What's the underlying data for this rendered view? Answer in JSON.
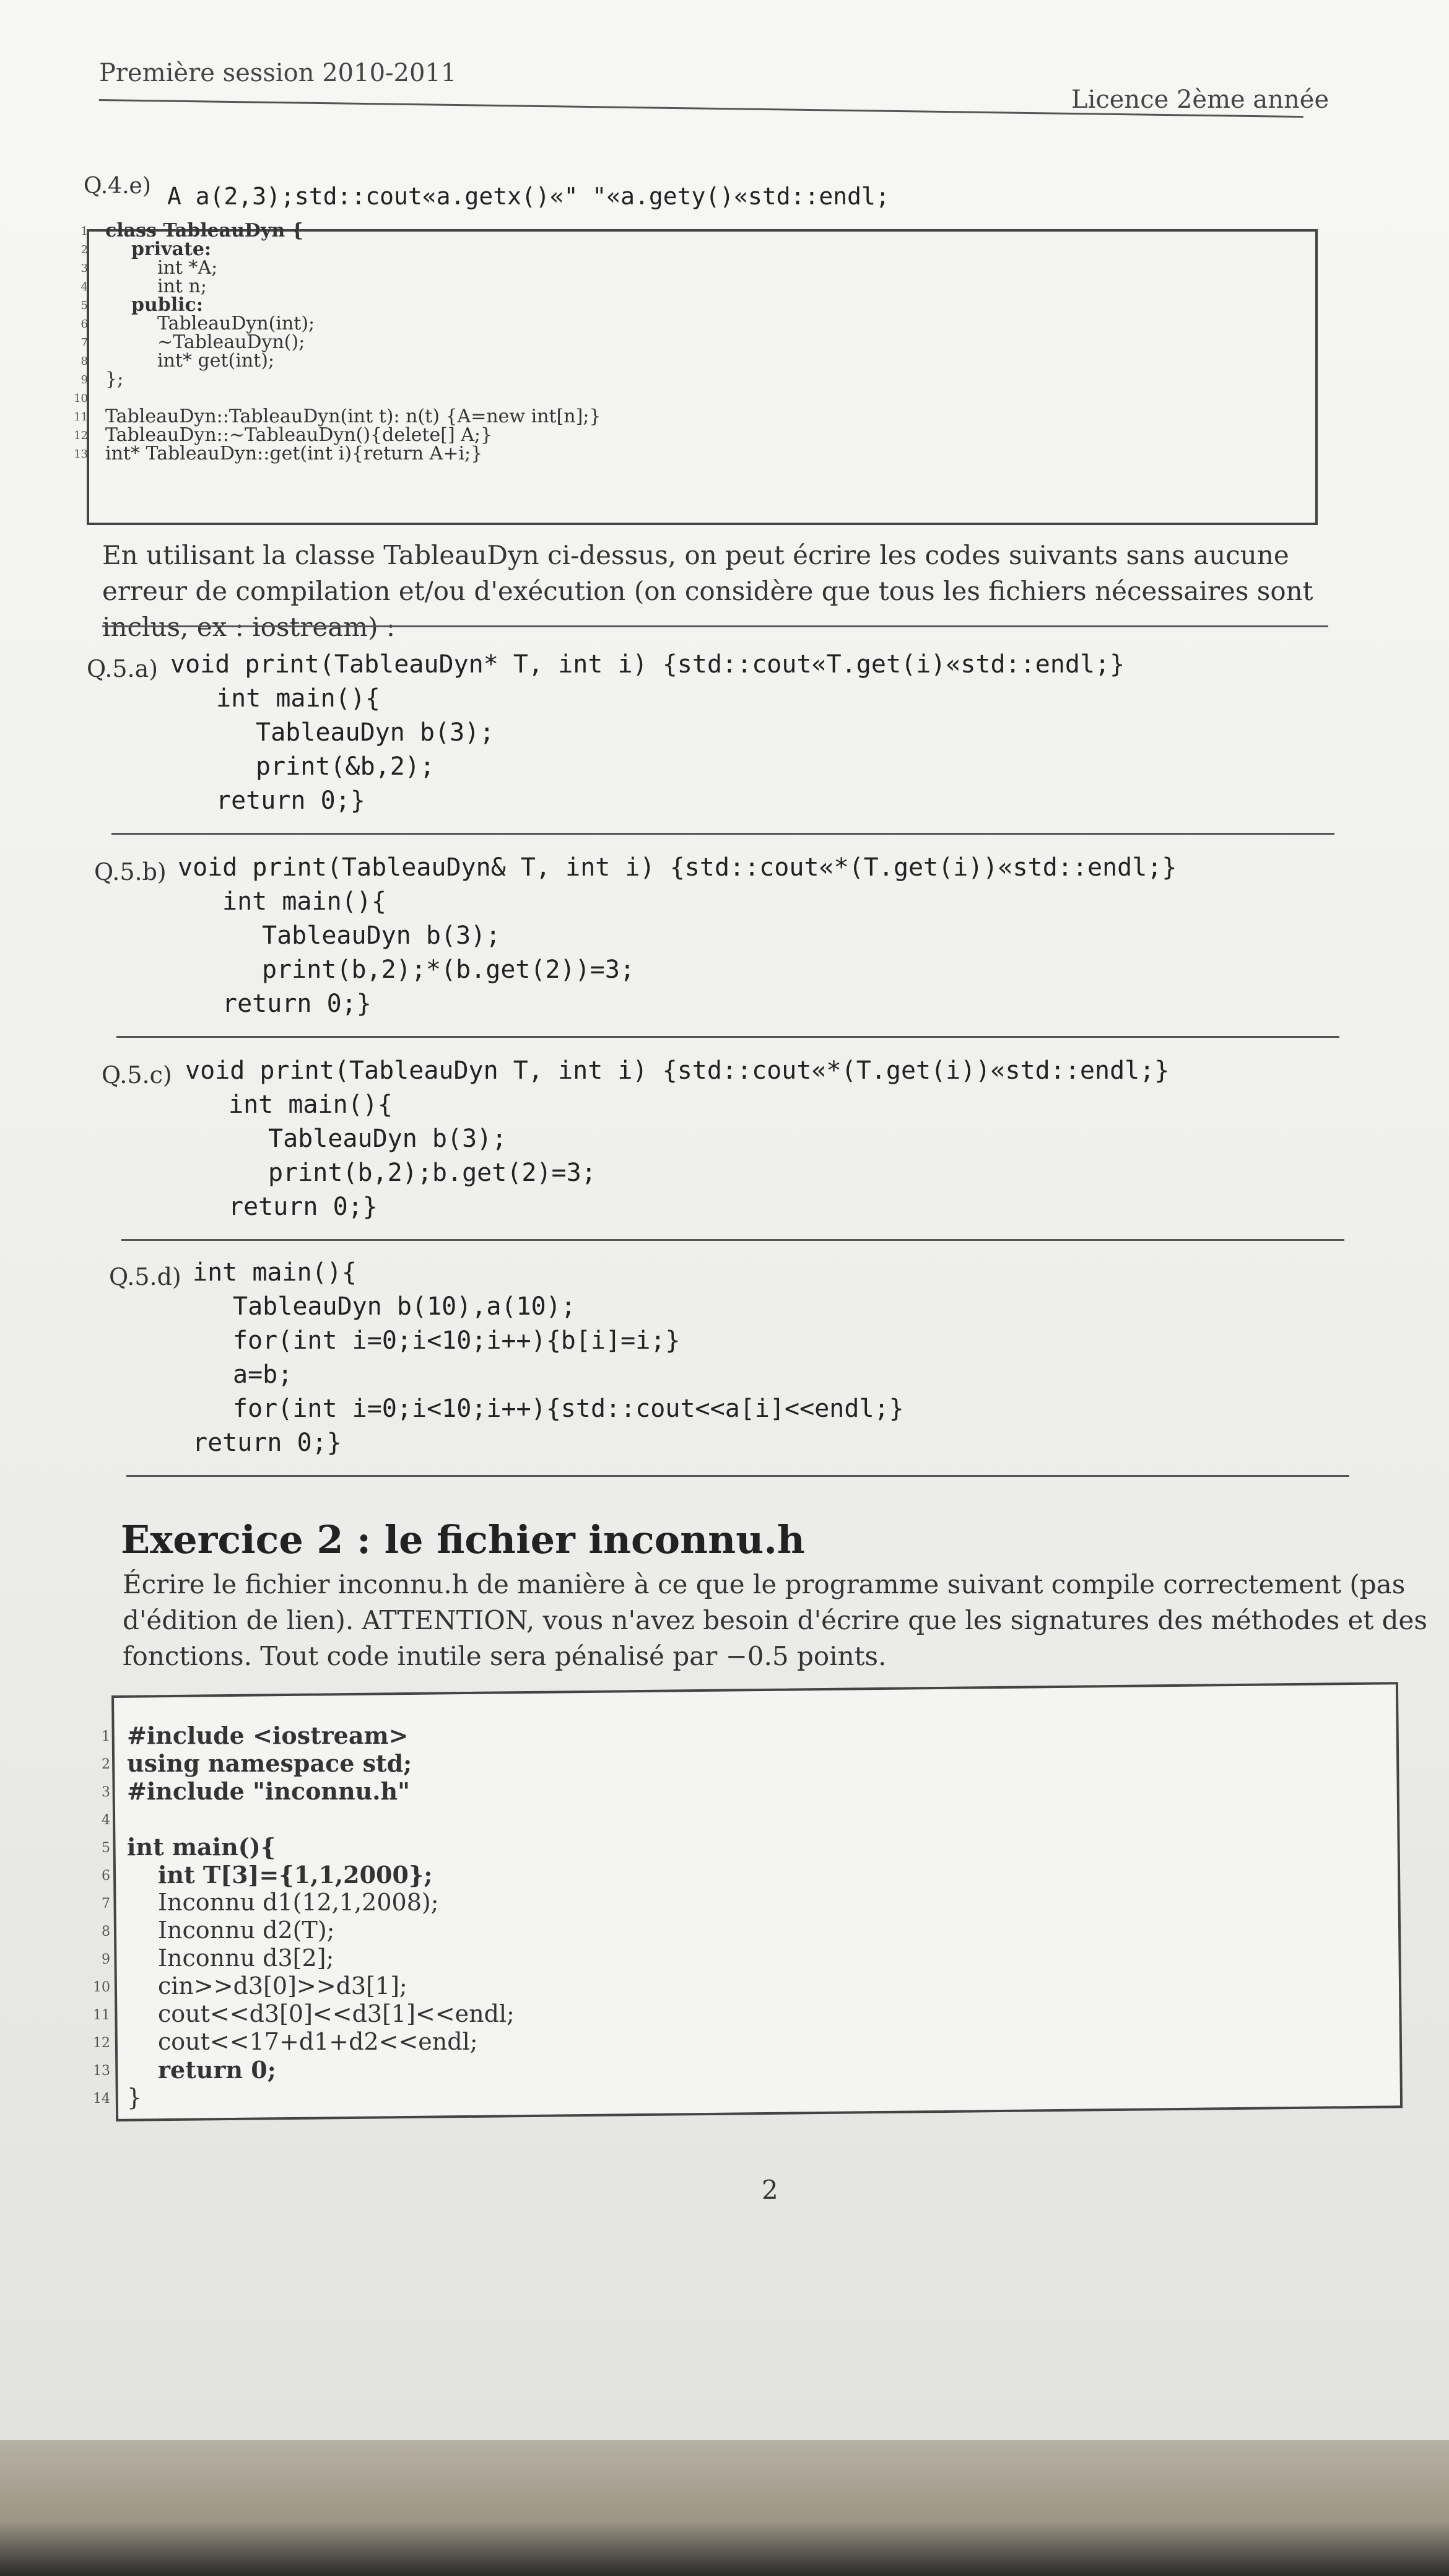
{
  "header": {
    "left": "Première session 2010-2011",
    "right": "Licence 2ème année"
  },
  "q4e": {
    "label": "Q.4.e)",
    "code": "A a(2,3);std::cout«a.getx()«\" \"«a.gety()«std::endl;"
  },
  "listing1": {
    "line_numbers": [
      "1",
      "2",
      "3",
      "4",
      "5",
      "6",
      "7",
      "8",
      "9",
      "10",
      "11",
      "12",
      "13"
    ],
    "lines": [
      "class TableauDyn {",
      "private:",
      "int *A;",
      "int n;",
      "public:",
      "TableauDyn(int);",
      "~TableauDyn();",
      "int* get(int);",
      "};",
      "",
      "TableauDyn::TableauDyn(int t): n(t) {A=new int[n];}",
      "TableauDyn::~TableauDyn(){delete[] A;}",
      "int* TableauDyn::get(int i){return A+i;}"
    ]
  },
  "intro": "En utilisant la classe TableauDyn ci-dessus, on peut écrire les codes suivants sans aucune erreur de compilation et/ou d'exécution (on considère que tous les fichiers nécessaires sont inclus, ex : iostream) :",
  "questions": [
    {
      "label": "Q.5.a)",
      "lines": [
        "void print(TableauDyn* T, int i) {std::cout«T.get(i)«std::endl;}",
        "int main(){",
        "TableauDyn b(3);",
        "print(&b,2);",
        "return 0;}"
      ]
    },
    {
      "label": "Q.5.b)",
      "lines": [
        "void print(TableauDyn& T, int i) {std::cout«*(T.get(i))«std::endl;}",
        "int main(){",
        "TableauDyn b(3);",
        "print(b,2);*(b.get(2))=3;",
        "return 0;}"
      ]
    },
    {
      "label": "Q.5.c)",
      "lines": [
        "void print(TableauDyn T, int i) {std::cout«*(T.get(i))«std::endl;}",
        "int main(){",
        "TableauDyn b(3);",
        "print(b,2);b.get(2)=3;",
        "return 0;}"
      ]
    },
    {
      "label": "Q.5.d)",
      "lines": [
        "int main(){",
        "TableauDyn b(10),a(10);",
        "for(int i=0;i<10;i++){b[i]=i;}",
        "a=b;",
        "for(int i=0;i<10;i++){std::cout<<a[i]<<endl;}",
        "return 0;}"
      ]
    }
  ],
  "exercise2": {
    "title": "Exercice 2 : le fichier inconnu.h",
    "para": [
      "Écrire le fichier inconnu.h de manière à ce que le programme suivant compile correctement (pas",
      "d'édition de lien). ATTENTION, vous n'avez besoin d'écrire que les signatures des méthodes et des",
      "fonctions. Tout code inutile sera pénalisé par −0.5 points."
    ],
    "listing": {
      "line_numbers": [
        "1",
        "2",
        "3",
        "4",
        "5",
        "6",
        "7",
        "8",
        "9",
        "10",
        "11",
        "12",
        "13",
        "14"
      ],
      "lines": [
        "#include <iostream>",
        "using namespace std;",
        "#include \"inconnu.h\"",
        "",
        "int main(){",
        "int T[3]={1,1,2000};",
        "Inconnu d1(12,1,2008);",
        "Inconnu d2(T);",
        "Inconnu d3[2];",
        "cin>>d3[0]>>d3[1];",
        "cout<<d3[0]<<d3[1]<<endl;",
        "cout<<17+d1+d2<<endl;",
        "return 0;",
        "}"
      ]
    }
  },
  "page_number": "2"
}
